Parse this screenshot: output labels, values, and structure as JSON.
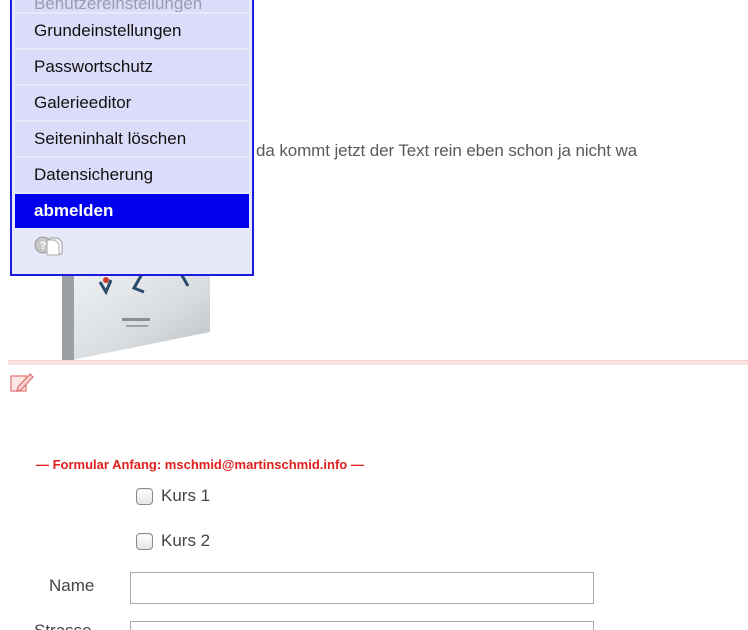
{
  "content": {
    "body_text": "da kommt jetzt der Text rein eben schon ja nicht wa"
  },
  "icons": {
    "edit": "edit-pencil-icon",
    "help": "help-icon",
    "pages": "pages-icon"
  },
  "menu": {
    "items": [
      {
        "label": "Benutzereinstellungen",
        "state": "faded"
      },
      {
        "label": "Grundeinstellungen",
        "state": "normal"
      },
      {
        "label": "Passwortschutz",
        "state": "normal"
      },
      {
        "label": "Galerieeditor",
        "state": "normal"
      },
      {
        "label": "Seiteninhalt löschen",
        "state": "normal"
      },
      {
        "label": "Datensicherung",
        "state": "normal"
      },
      {
        "label": "abmelden",
        "state": "active"
      }
    ]
  },
  "form": {
    "start_label": "— Formular Anfang: mschmid@martinschmid.info —",
    "checkboxes": [
      {
        "label": "Kurs 1",
        "checked": false
      },
      {
        "label": "Kurs 2",
        "checked": false
      }
    ],
    "fields": [
      {
        "label": "Name",
        "value": ""
      },
      {
        "label": "Strasse",
        "value": ""
      }
    ]
  },
  "colors": {
    "menu_border": "#1c1ce0",
    "menu_bg": "#e8e8fb",
    "menu_active": "#0000ee",
    "form_marker": "#e0201c",
    "divider": "#fbe3e3"
  }
}
